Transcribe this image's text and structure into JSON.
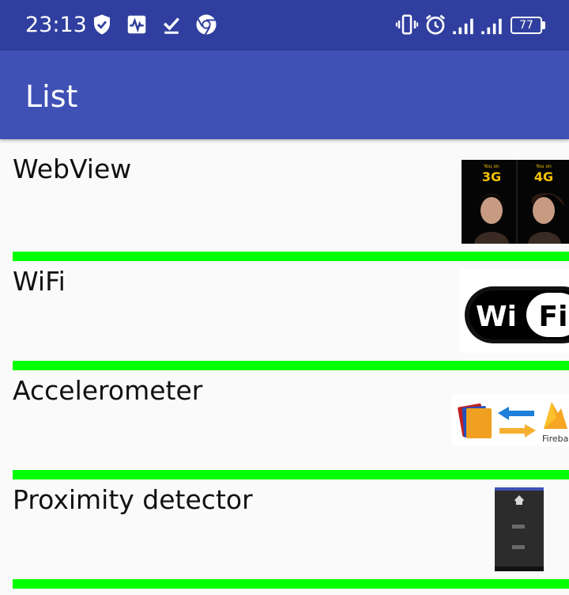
{
  "status_bar": {
    "time": "23:13",
    "battery": "77",
    "icons": [
      "shield-check-icon",
      "pulse-icon",
      "download-done-icon",
      "chrome-icon",
      "vibrate-icon",
      "alarm-icon",
      "signal-icon",
      "signal-icon",
      "battery-icon"
    ]
  },
  "app_bar": {
    "title": "List"
  },
  "list": {
    "items": [
      {
        "label": "WebView",
        "image": "3g-4g-thumbnail"
      },
      {
        "label": "WiFi",
        "image": "wifi-logo-thumbnail"
      },
      {
        "label": "Accelerometer",
        "image": "folder-transfer-firebase-thumbnail",
        "image_text": "Fireba"
      },
      {
        "label": "Proximity detector",
        "image": "phone-screenshot-thumbnail"
      }
    ]
  },
  "thumb_text": {
    "you_on": "You on",
    "g3": "3G",
    "g4": "4G",
    "wi": "Wi",
    "fi": "Fi"
  },
  "colors": {
    "status_bar": "#303f9f",
    "app_bar": "#3f51b5",
    "divider": "#00ff00",
    "background": "#fafafa"
  }
}
